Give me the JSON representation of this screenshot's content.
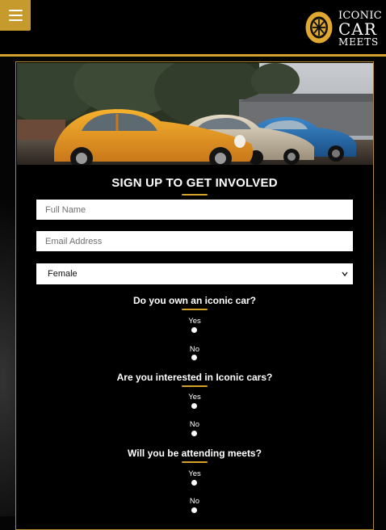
{
  "header": {
    "menu_icon": "hamburger-icon",
    "logo": {
      "line1": "ICONIC",
      "line2": "CAR",
      "line3": "MEETS",
      "icon": "wheel-icon"
    },
    "accent_color": "#d4a22b"
  },
  "form": {
    "title": "SIGN UP TO GET INVOLVED",
    "full_name": {
      "placeholder": "Full Name",
      "value": ""
    },
    "email": {
      "placeholder": "Email Address",
      "value": ""
    },
    "gender": {
      "selected": "Female"
    },
    "questions": [
      {
        "text": "Do you own an iconic car?",
        "options": [
          "Yes",
          "No"
        ]
      },
      {
        "text": "Are you interested in Iconic cars?",
        "options": [
          "Yes",
          "No"
        ]
      },
      {
        "text": "Will you be attending meets?",
        "options": [
          "Yes",
          "No"
        ]
      }
    ]
  }
}
